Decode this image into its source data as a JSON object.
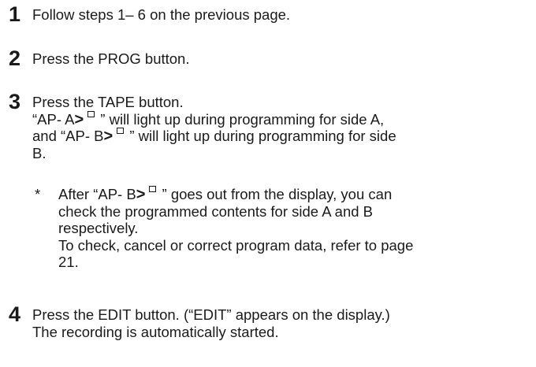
{
  "steps": [
    {
      "number": "1",
      "lines": [
        "Follow steps 1– 6 on the previous page."
      ]
    },
    {
      "number": "2",
      "lines": [
        "Press the PROG button."
      ]
    },
    {
      "number": "3",
      "lines": [
        "Press the TAPE button.",
        {
          "pre": "“AP- A",
          "gt": ">",
          "post": " ” will light up during programming for side A,"
        },
        {
          "pre": "and “AP- B",
          "gt": ">",
          "post": " ” will light up during programming for side"
        },
        "B."
      ]
    },
    {
      "number": "4",
      "lines": [
        "Press the EDIT button. (“EDIT” appears on the display.)",
        "The recording is automatically started."
      ]
    }
  ],
  "note": {
    "marker": "*",
    "lines": [
      {
        "pre": "After “AP- B",
        "gt": ">",
        "post": " ” goes out from the display, you can"
      },
      "check the programmed contents for side A and B",
      "respectively.",
      "To check, cancel or correct program data, refer to page",
      "21."
    ]
  },
  "icons": {
    "record_marker": "record-square-icon"
  }
}
